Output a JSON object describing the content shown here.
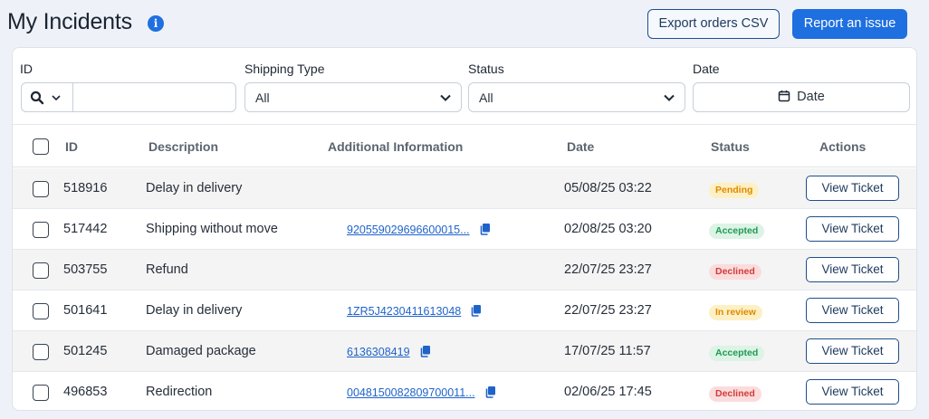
{
  "header": {
    "title": "My Incidents",
    "info_glyph": "i",
    "export_label": "Export orders CSV",
    "report_label": "Report an issue"
  },
  "filters": {
    "id_label": "ID",
    "id_value": "",
    "shipping_label": "Shipping Type",
    "shipping_value": "All",
    "status_label": "Status",
    "status_value": "All",
    "date_label": "Date",
    "date_placeholder": "Date"
  },
  "columns": {
    "id": "ID",
    "description": "Description",
    "additional": "Additional Information",
    "date": "Date",
    "status": "Status",
    "actions": "Actions"
  },
  "rows": [
    {
      "id": "518916",
      "description": "Delay in delivery",
      "additional": "",
      "date": "05/08/25 03:22",
      "status": "Pending",
      "action": "View Ticket"
    },
    {
      "id": "517442",
      "description": "Shipping without move",
      "additional": "920559029696600015...",
      "date": "02/08/25 03:20",
      "status": "Accepted",
      "action": "View Ticket"
    },
    {
      "id": "503755",
      "description": "Refund",
      "additional": "",
      "date": "22/07/25 23:27",
      "status": "Declined",
      "action": "View Ticket"
    },
    {
      "id": "501641",
      "description": "Delay in delivery",
      "additional": "1ZR5J4230411613048",
      "date": "22/07/25 23:27",
      "status": "In review",
      "action": "View Ticket"
    },
    {
      "id": "501245",
      "description": "Damaged package",
      "additional": "6136308419",
      "date": "17/07/25 11:57",
      "status": "Accepted",
      "action": "View Ticket"
    },
    {
      "id": "496853",
      "description": "Redirection",
      "additional": "0048150082809700011...",
      "date": "02/06/25 17:45",
      "status": "Declined",
      "action": "View Ticket"
    }
  ],
  "status_colors": {
    "Pending": {
      "bg": "#fdf0c4",
      "fg": "#e08a00"
    },
    "Accepted": {
      "bg": "#dcf3e5",
      "fg": "#1f9a52"
    },
    "Declined": {
      "bg": "#fbdcdc",
      "fg": "#d33a3a"
    },
    "In review": {
      "bg": "#fdf0c4",
      "fg": "#e08a00"
    }
  },
  "icons": {
    "info": "info-icon",
    "search": "search-icon",
    "chevron": "chevron-down-icon",
    "calendar": "calendar-icon",
    "copy": "copy-icon"
  }
}
